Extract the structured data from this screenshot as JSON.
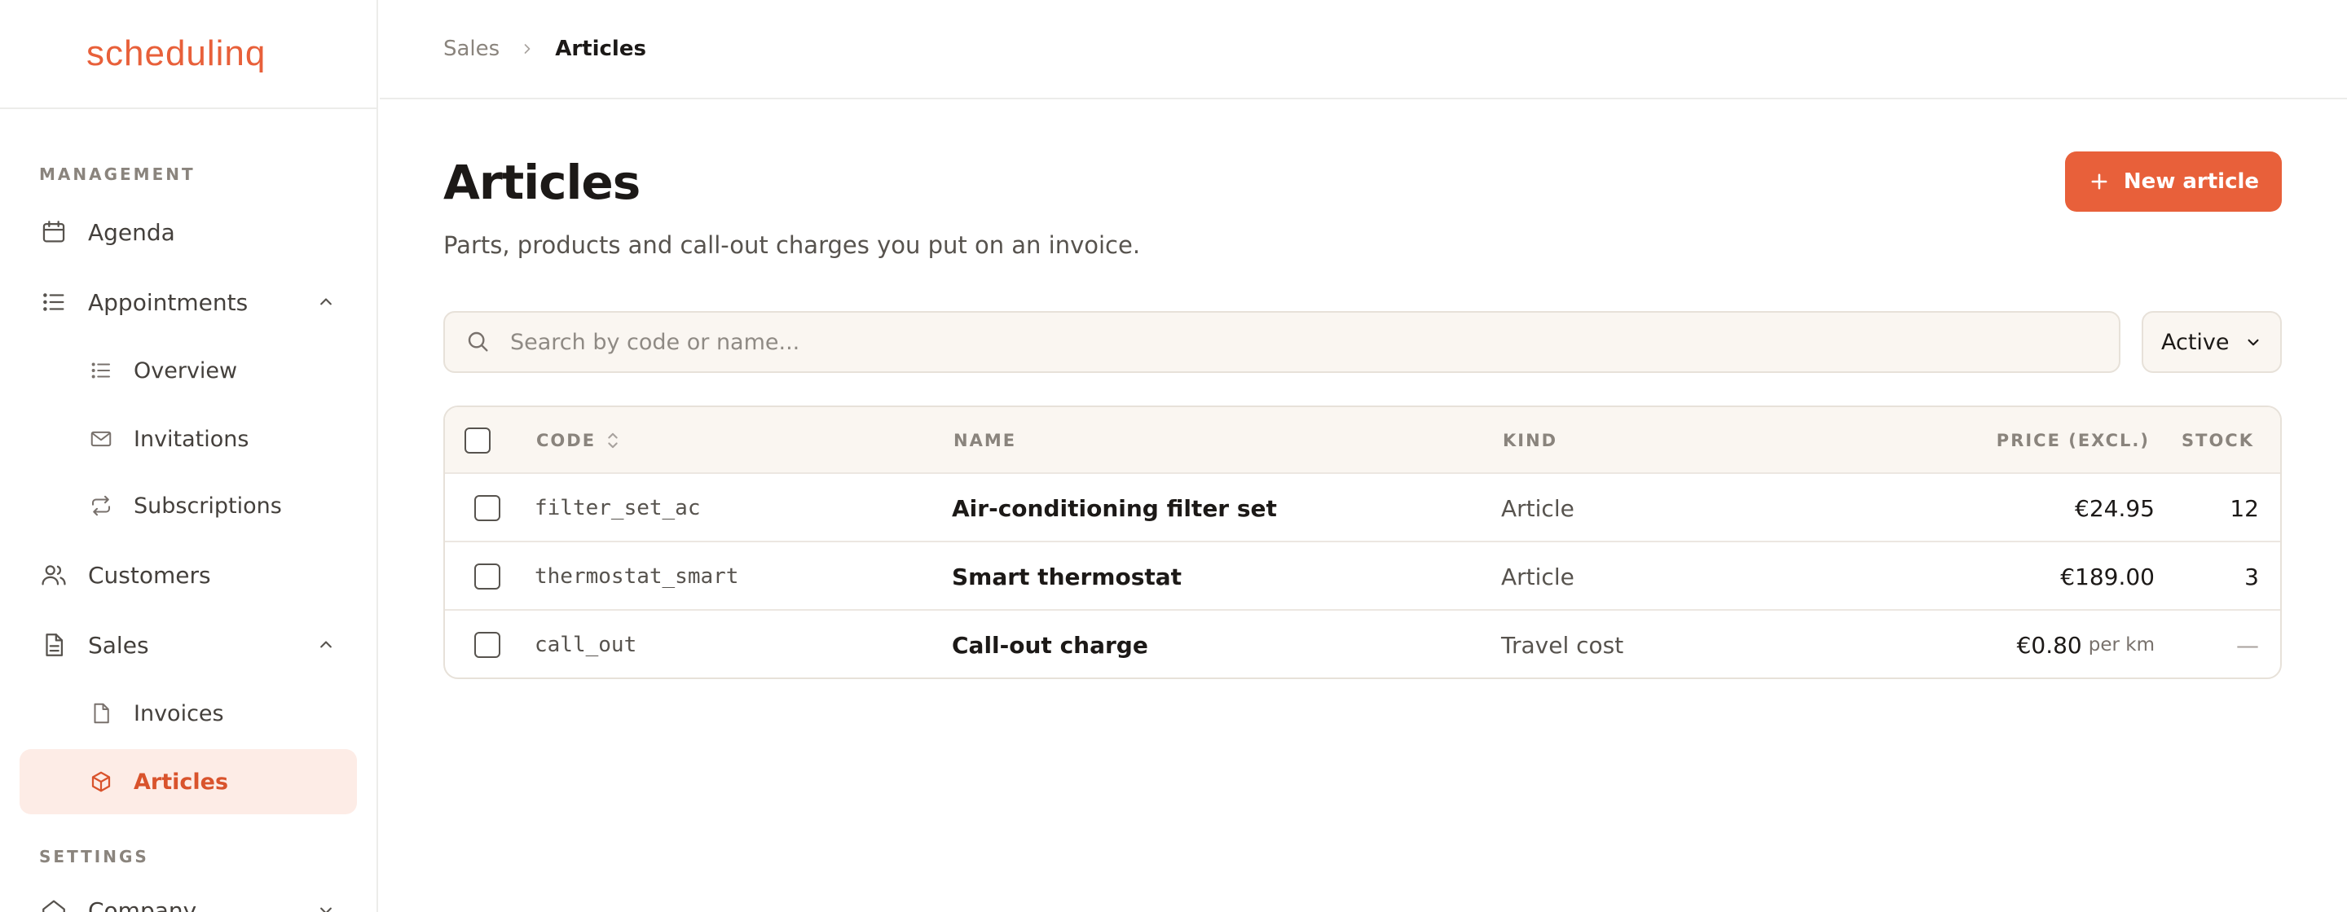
{
  "app": {
    "logo": "schedulinq"
  },
  "sidebar": {
    "sections": [
      {
        "label": "MANAGEMENT"
      },
      {
        "label": "SETTINGS"
      }
    ],
    "items": [
      {
        "label": "Agenda",
        "icon": "calendar-icon"
      },
      {
        "label": "Appointments",
        "icon": "list-icon",
        "expanded": true
      },
      {
        "label": "Overview",
        "icon": "list-icon"
      },
      {
        "label": "Invitations",
        "icon": "mail-icon"
      },
      {
        "label": "Subscriptions",
        "icon": "repeat-icon"
      },
      {
        "label": "Customers",
        "icon": "users-icon"
      },
      {
        "label": "Sales",
        "icon": "document-icon",
        "expanded": true
      },
      {
        "label": "Invoices",
        "icon": "file-icon"
      },
      {
        "label": "Articles",
        "icon": "box-icon",
        "active": true
      },
      {
        "label": "Company",
        "icon": "home-icon"
      }
    ]
  },
  "breadcrumb": {
    "parent": "Sales",
    "current": "Articles"
  },
  "page": {
    "title": "Articles",
    "subtitle": "Parts, products and call-out charges you put on an invoice.",
    "new_button": "New article"
  },
  "search": {
    "placeholder": "Search by code or name...",
    "value": ""
  },
  "filter": {
    "selected": "Active"
  },
  "table": {
    "headers": {
      "code": "CODE",
      "name": "NAME",
      "kind": "KIND",
      "price": "PRICE (EXCL.)",
      "stock": "STOCK"
    },
    "rows": [
      {
        "code": "filter_set_ac",
        "name": "Air-conditioning filter set",
        "kind": "Article",
        "price": "€24.95",
        "unit": "",
        "stock": "12"
      },
      {
        "code": "thermostat_smart",
        "name": "Smart thermostat",
        "kind": "Article",
        "price": "€189.00",
        "unit": "",
        "stock": "3"
      },
      {
        "code": "call_out",
        "name": "Call-out charge",
        "kind": "Travel cost",
        "price": "€0.80",
        "unit": "per km",
        "stock": "—"
      }
    ]
  },
  "colors": {
    "accent": "#e8603a",
    "active_bg": "#fdece6",
    "surface": "#faf6f1"
  }
}
